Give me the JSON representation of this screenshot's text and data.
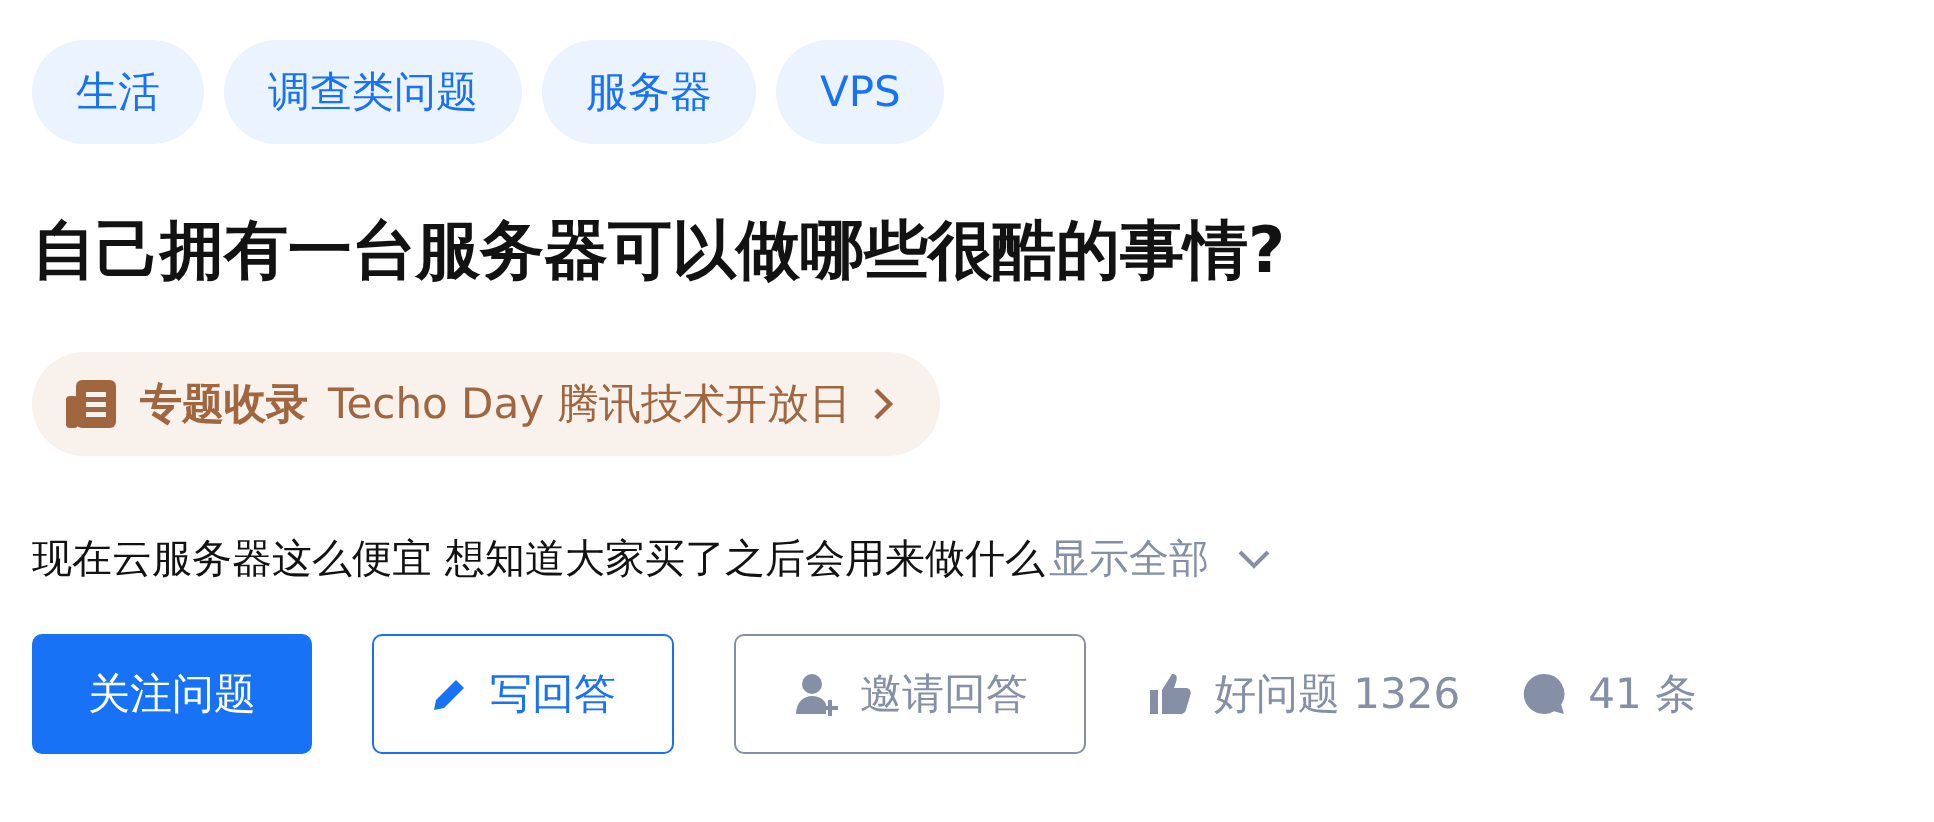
{
  "tags": [
    "生活",
    "调查类问题",
    "服务器",
    "VPS"
  ],
  "title": "自己拥有一台服务器可以做哪些很酷的事情?",
  "topic": {
    "label": "专题收录",
    "name": "Techo Day 腾讯技术开放日"
  },
  "description": {
    "text": "现在云服务器这么便宜 想知道大家买了之后会用来做什么",
    "more": "显示全部"
  },
  "actions": [
    {
      "kind": "primary",
      "label": "关注问题"
    },
    {
      "kind": "outline-blue",
      "label": "写回答"
    },
    {
      "kind": "outline-grey",
      "label": "邀请回答"
    }
  ],
  "stats": [
    {
      "kind": "like",
      "label": "好问题 1326"
    },
    {
      "kind": "comment",
      "label": "41 条"
    }
  ]
}
